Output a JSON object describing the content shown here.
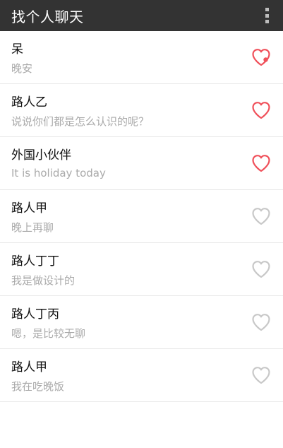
{
  "app": {
    "title": "找个人聊天"
  },
  "colors": {
    "topbar": "#333333",
    "heart_active": "#f0505a",
    "heart_inactive": "#c8c8c8"
  },
  "chats": [
    {
      "name": "呆",
      "message": "晚安",
      "favorited": true
    },
    {
      "name": "路人乙",
      "message": "说说你们都是怎么认识的呢？",
      "favorited": true
    },
    {
      "name": "外国小伙伴",
      "message": "It is holiday today",
      "favorited": true
    },
    {
      "name": "路人甲",
      "message": "晚上再聊",
      "favorited": false
    },
    {
      "name": "路人丁丁",
      "message": "我是做设计的",
      "favorited": false
    },
    {
      "name": "路人丁丙",
      "message": "嗯，是比较无聊",
      "favorited": false
    },
    {
      "name": "路人甲",
      "message": "我在吃晚饭",
      "favorited": false
    }
  ]
}
